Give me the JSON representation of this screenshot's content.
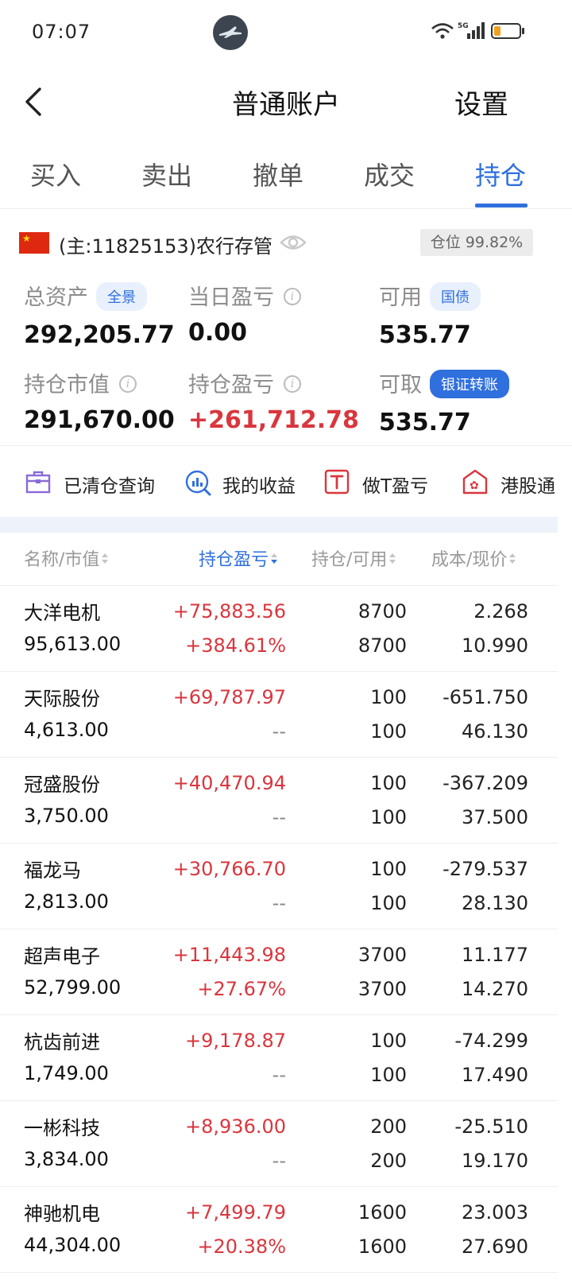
{
  "status_bar": {
    "time": "07:07",
    "network": "5G"
  },
  "header": {
    "title": "普通账户",
    "settings_label": "设置"
  },
  "tabs": [
    {
      "label": "买入"
    },
    {
      "label": "卖出"
    },
    {
      "label": "撤单"
    },
    {
      "label": "成交"
    },
    {
      "label": "持仓",
      "active": true
    }
  ],
  "account": {
    "text": "(主:11825153)农行存管",
    "position_badge": "仓位 99.82%"
  },
  "metrics": {
    "total_assets": {
      "label": "总资产",
      "chip": "全景",
      "value": "292,205.77"
    },
    "daily_pl": {
      "label": "当日盈亏",
      "value": "0.00"
    },
    "available": {
      "label": "可用",
      "chip": "国债",
      "value": "535.77"
    },
    "market_value": {
      "label": "持仓市值",
      "value": "291,670.00"
    },
    "position_pl": {
      "label": "持仓盈亏",
      "value": "+261,712.78"
    },
    "withdrawable": {
      "label": "可取",
      "chip": "银证转账",
      "value": "535.77"
    }
  },
  "tools": [
    {
      "label": "已清仓查询",
      "icon": "briefcase-icon"
    },
    {
      "label": "我的收益",
      "icon": "chart-search-icon"
    },
    {
      "label": "做T盈亏",
      "icon": "t-box-icon"
    },
    {
      "label": "港股通",
      "icon": "hk-icon"
    }
  ],
  "table": {
    "headers": [
      "名称/市值",
      "持仓盈亏",
      "持仓/可用",
      "成本/现价"
    ],
    "rows": [
      {
        "name": "大洋电机",
        "market_value": "95,613.00",
        "pl": "+75,883.56",
        "pl_pct": "+384.61%",
        "hold": "8700",
        "available": "8700",
        "cost": "2.268",
        "price": "10.990"
      },
      {
        "name": "天际股份",
        "market_value": "4,613.00",
        "pl": "+69,787.97",
        "pl_pct": "--",
        "hold": "100",
        "available": "100",
        "cost": "-651.750",
        "price": "46.130"
      },
      {
        "name": "冠盛股份",
        "market_value": "3,750.00",
        "pl": "+40,470.94",
        "pl_pct": "--",
        "hold": "100",
        "available": "100",
        "cost": "-367.209",
        "price": "37.500"
      },
      {
        "name": "福龙马",
        "market_value": "2,813.00",
        "pl": "+30,766.70",
        "pl_pct": "--",
        "hold": "100",
        "available": "100",
        "cost": "-279.537",
        "price": "28.130"
      },
      {
        "name": "超声电子",
        "market_value": "52,799.00",
        "pl": "+11,443.98",
        "pl_pct": "+27.67%",
        "hold": "3700",
        "available": "3700",
        "cost": "11.177",
        "price": "14.270"
      },
      {
        "name": "杭齿前进",
        "market_value": "1,749.00",
        "pl": "+9,178.87",
        "pl_pct": "--",
        "hold": "100",
        "available": "100",
        "cost": "-74.299",
        "price": "17.490"
      },
      {
        "name": "一彬科技",
        "market_value": "3,834.00",
        "pl": "+8,936.00",
        "pl_pct": "--",
        "hold": "200",
        "available": "200",
        "cost": "-25.510",
        "price": "19.170"
      },
      {
        "name": "神驰机电",
        "market_value": "44,304.00",
        "pl": "+7,499.79",
        "pl_pct": "+20.38%",
        "hold": "1600",
        "available": "1600",
        "cost": "23.003",
        "price": "27.690"
      }
    ]
  }
}
